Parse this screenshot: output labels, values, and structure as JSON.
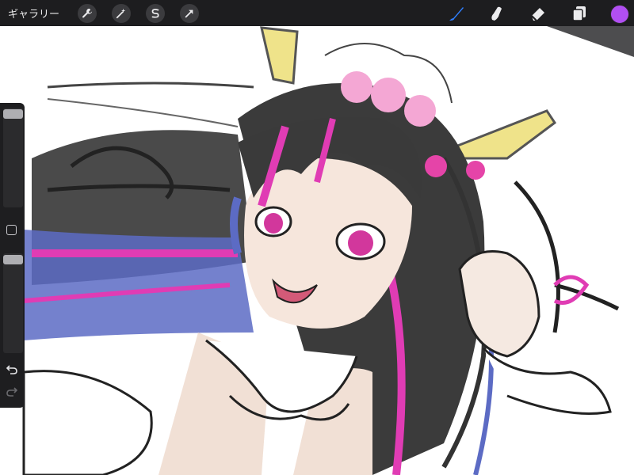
{
  "app": {
    "gallery_label": "ギャラリー"
  },
  "toolbar": {
    "left_tools": [
      {
        "name": "actions-icon"
      },
      {
        "name": "adjustments-icon"
      },
      {
        "name": "selection-icon"
      },
      {
        "name": "transform-icon"
      }
    ],
    "right_tools": [
      {
        "name": "brush-icon",
        "active": true
      },
      {
        "name": "smudge-icon",
        "active": false
      },
      {
        "name": "eraser-icon",
        "active": false
      },
      {
        "name": "layers-icon",
        "active": false
      }
    ],
    "current_color": "#b14ff2",
    "active_tool_color": "#2f7fff"
  },
  "sidebar": {
    "brush_size": 0.95,
    "opacity": 0.95,
    "undo_icon": "undo-icon",
    "redo_icon": "redo-icon"
  }
}
